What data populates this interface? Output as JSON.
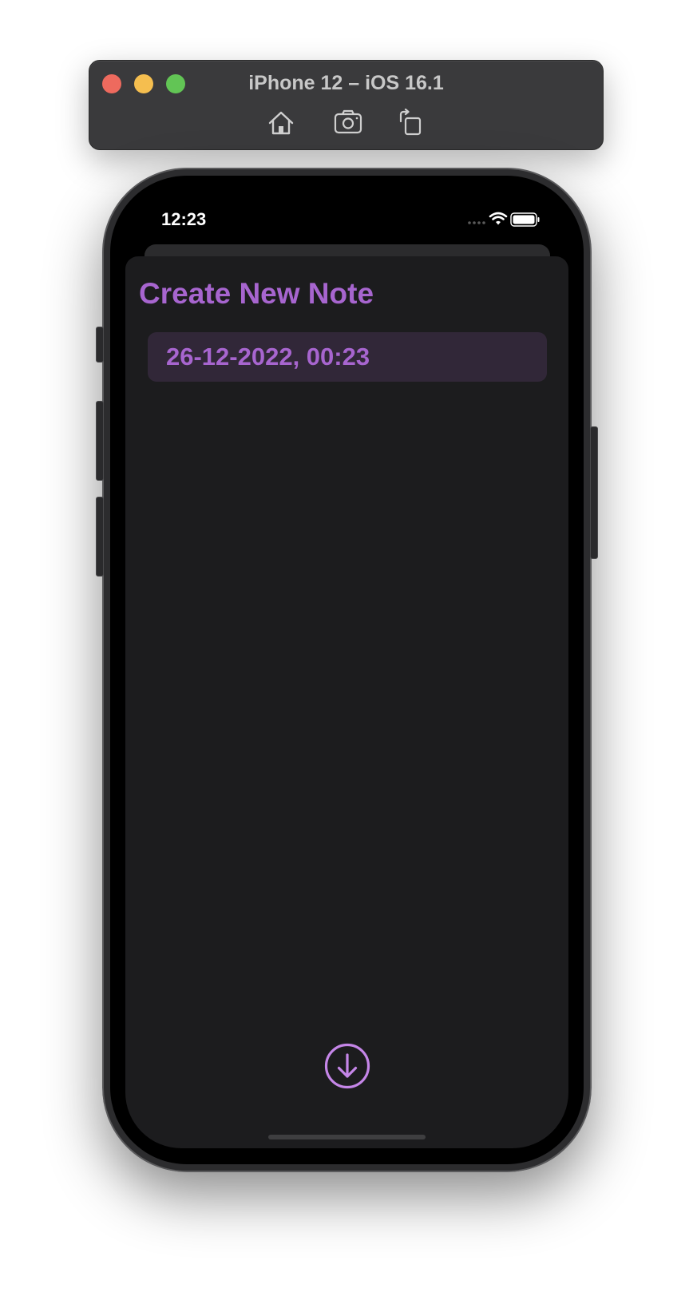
{
  "simulator": {
    "title": "iPhone 12 – iOS 16.1",
    "toolbar": {
      "home_icon": "home-icon",
      "screenshot_icon": "camera-icon",
      "rotate_icon": "rotate-icon"
    },
    "traffic_lights": {
      "close_color": "#ee6a5e",
      "minimize_color": "#f5be4f",
      "zoom_color": "#62c555"
    }
  },
  "status_bar": {
    "time": "12:23",
    "icons": [
      "cellular-icon",
      "wifi-icon",
      "battery-icon"
    ]
  },
  "sheet": {
    "title": "Create New Note",
    "date_value": "26-12-2022, 00:23",
    "save_icon": "arrow-down-circle-icon"
  },
  "colors": {
    "accent": "#a765cf",
    "sheet_background": "#1c1c1e",
    "date_field_background": "#312738"
  }
}
